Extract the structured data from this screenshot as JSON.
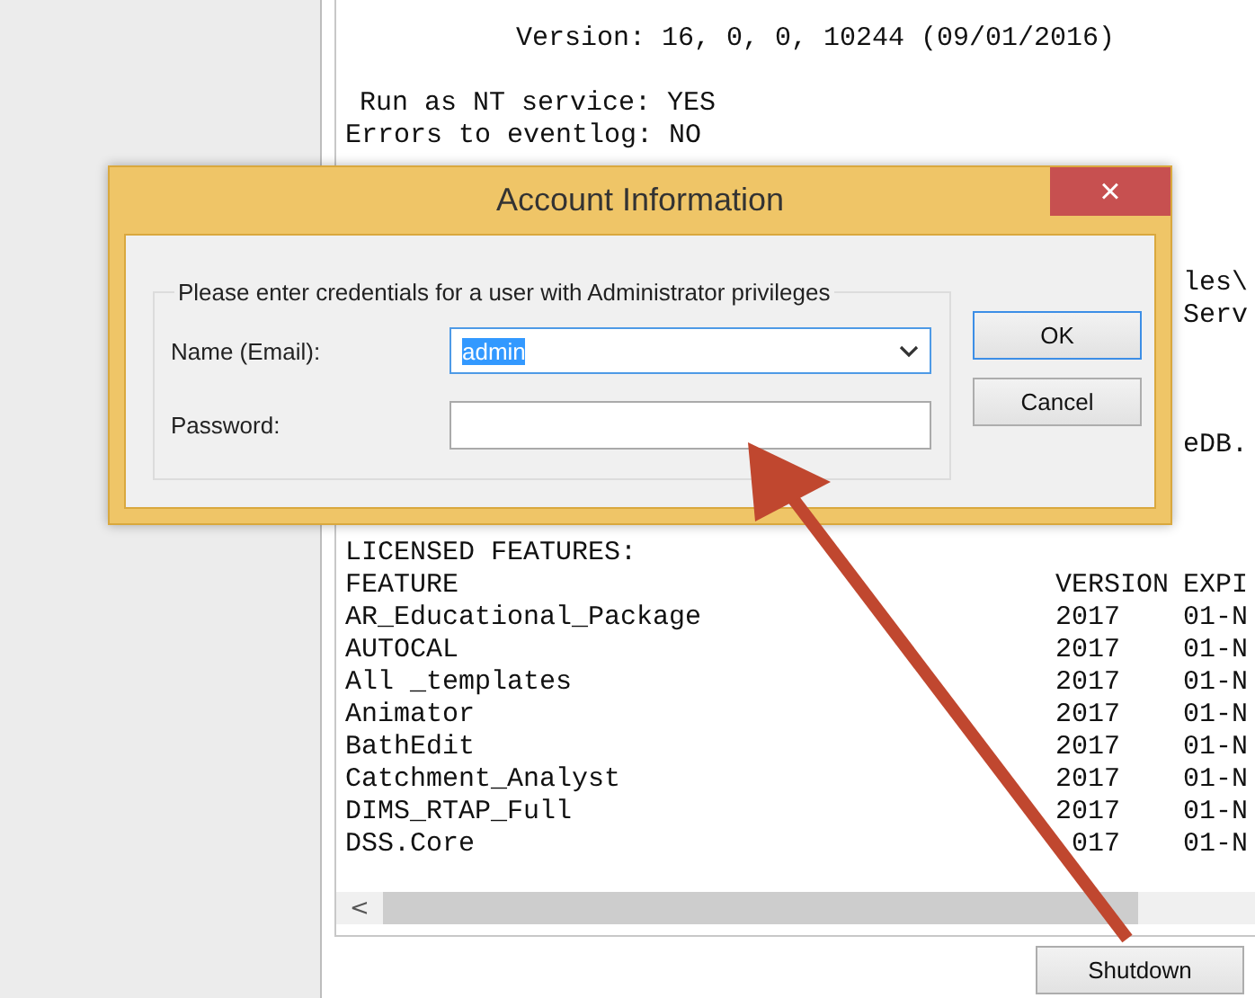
{
  "console": {
    "version_line": "Version: 16, 0, 0, 10244 (09/01/2016)",
    "lines": [
      "Run as NT service: YES",
      "Errors to eventlog: NO"
    ],
    "partial_lines": [
      "les\\",
      "Serv",
      "eDB."
    ],
    "features": {
      "title": "LICENSED FEATURES:",
      "columns": [
        "FEATURE",
        "VERSION",
        "EXPI"
      ],
      "rows": [
        {
          "feature": "AR_Educational_Package",
          "version": "2017",
          "expires": "01-N"
        },
        {
          "feature": "AUTOCAL",
          "version": "2017",
          "expires": "01-N"
        },
        {
          "feature": "All _templates",
          "version": "2017",
          "expires": "01-N"
        },
        {
          "feature": "Animator",
          "version": "2017",
          "expires": "01-N"
        },
        {
          "feature": "BathEdit",
          "version": "2017",
          "expires": "01-N"
        },
        {
          "feature": "Catchment_Analyst",
          "version": "2017",
          "expires": "01-N"
        },
        {
          "feature": "DIMS_RTAP_Full",
          "version": "2017",
          "expires": "01-N"
        },
        {
          "feature": "DSS.Core",
          "version": "017",
          "expires": "01-N"
        }
      ]
    },
    "scroll_left": "<"
  },
  "shutdown_button": "Shutdown",
  "dialog": {
    "title": "Account Information",
    "close": "×",
    "group_label": "Please enter credentials for a user with Administrator privileges",
    "name_label": "Name (Email):",
    "name_value": "admin",
    "password_label": "Password:",
    "buttons": [
      {
        "label": "OK",
        "default": true
      },
      {
        "label": "Cancel",
        "default": false
      }
    ]
  }
}
